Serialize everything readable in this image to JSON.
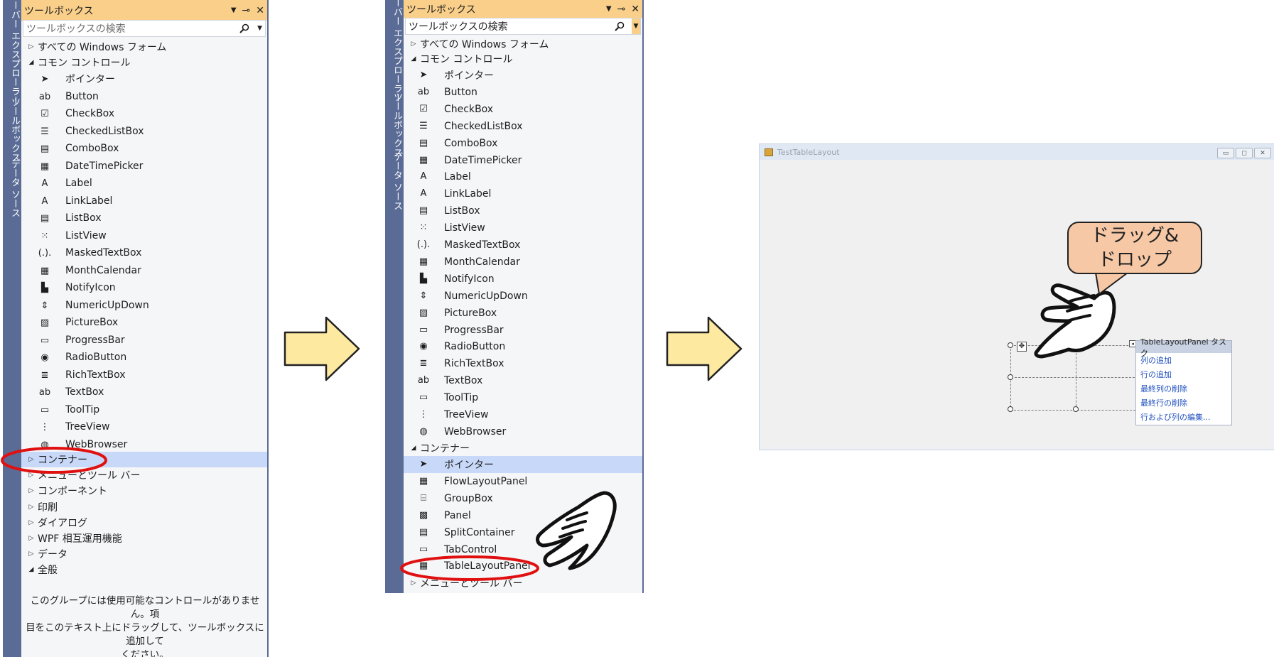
{
  "toolbox_1": {
    "side_tabs": [
      "サーバー エクスプローラー",
      "ツールボックス",
      "データ ソース"
    ],
    "title": "ツールボックス",
    "title_icons": [
      "▼",
      "⊸",
      "✕"
    ],
    "search_placeholder": "ツールボックスの検索",
    "groups_top": [
      {
        "label": "すべての Windows フォーム",
        "expanded": false
      },
      {
        "label": "コモン コントロール",
        "expanded": true
      }
    ],
    "items": [
      {
        "label": "ポインター",
        "icon": "pointer-icon",
        "glyph": "➤"
      },
      {
        "label": "Button",
        "icon": "button-icon",
        "glyph": "ab"
      },
      {
        "label": "CheckBox",
        "icon": "checkbox-icon",
        "glyph": "☑"
      },
      {
        "label": "CheckedListBox",
        "icon": "checked-list-icon",
        "glyph": "☰"
      },
      {
        "label": "ComboBox",
        "icon": "combobox-icon",
        "glyph": "▤"
      },
      {
        "label": "DateTimePicker",
        "icon": "datetime-icon",
        "glyph": "▦"
      },
      {
        "label": "Label",
        "icon": "label-icon",
        "glyph": "A"
      },
      {
        "label": "LinkLabel",
        "icon": "linklabel-icon",
        "glyph": "A"
      },
      {
        "label": "ListBox",
        "icon": "listbox-icon",
        "glyph": "▤"
      },
      {
        "label": "ListView",
        "icon": "listview-icon",
        "glyph": "⁙"
      },
      {
        "label": "MaskedTextBox",
        "icon": "masked-textbox-icon",
        "glyph": "(.)."
      },
      {
        "label": "MonthCalendar",
        "icon": "calendar-icon",
        "glyph": "▦"
      },
      {
        "label": "NotifyIcon",
        "icon": "notify-icon",
        "glyph": "▙"
      },
      {
        "label": "NumericUpDown",
        "icon": "numeric-updown-icon",
        "glyph": "⇕"
      },
      {
        "label": "PictureBox",
        "icon": "picturebox-icon",
        "glyph": "▨"
      },
      {
        "label": "ProgressBar",
        "icon": "progressbar-icon",
        "glyph": "▭"
      },
      {
        "label": "RadioButton",
        "icon": "radio-icon",
        "glyph": "◉"
      },
      {
        "label": "RichTextBox",
        "icon": "richtext-icon",
        "glyph": "≣"
      },
      {
        "label": "TextBox",
        "icon": "textbox-icon",
        "glyph": "ab"
      },
      {
        "label": "ToolTip",
        "icon": "tooltip-icon",
        "glyph": "▭"
      },
      {
        "label": "TreeView",
        "icon": "treeview-icon",
        "glyph": "⋮"
      },
      {
        "label": "WebBrowser",
        "icon": "webbrowser-icon",
        "glyph": "◍"
      }
    ],
    "groups_bottom": [
      {
        "label": "コンテナー",
        "expanded": false,
        "selected": true
      },
      {
        "label": "メニューとツール バー",
        "expanded": false
      },
      {
        "label": "コンポーネント",
        "expanded": false
      },
      {
        "label": "印刷",
        "expanded": false
      },
      {
        "label": "ダイアログ",
        "expanded": false
      },
      {
        "label": "WPF 相互運用機能",
        "expanded": false
      },
      {
        "label": "データ",
        "expanded": false
      },
      {
        "label": "全般",
        "expanded": true
      }
    ],
    "empty_note_lines": [
      "このグループには使用可能なコントロールがありません。項",
      "目をこのテキスト上にドラッグして、ツールボックスに追加して",
      "ください。"
    ]
  },
  "toolbox_2": {
    "side_tabs": [
      "サーバー エクスプローラー",
      "ツールボックス",
      "データ ソース"
    ],
    "title": "ツールボックス",
    "title_icons": [
      "▼",
      "⊸",
      "✕"
    ],
    "search_text": "ツールボックスの検索",
    "groups_top": [
      {
        "label": "すべての Windows フォーム",
        "expanded": false
      },
      {
        "label": "コモン コントロール",
        "expanded": true
      }
    ],
    "items": [
      {
        "label": "ポインター",
        "icon": "pointer-icon",
        "glyph": "➤"
      },
      {
        "label": "Button",
        "icon": "button-icon",
        "glyph": "ab"
      },
      {
        "label": "CheckBox",
        "icon": "checkbox-icon",
        "glyph": "☑"
      },
      {
        "label": "CheckedListBox",
        "icon": "checked-list-icon",
        "glyph": "☰"
      },
      {
        "label": "ComboBox",
        "icon": "combobox-icon",
        "glyph": "▤"
      },
      {
        "label": "DateTimePicker",
        "icon": "datetime-icon",
        "glyph": "▦"
      },
      {
        "label": "Label",
        "icon": "label-icon",
        "glyph": "A"
      },
      {
        "label": "LinkLabel",
        "icon": "linklabel-icon",
        "glyph": "A"
      },
      {
        "label": "ListBox",
        "icon": "listbox-icon",
        "glyph": "▤"
      },
      {
        "label": "ListView",
        "icon": "listview-icon",
        "glyph": "⁙"
      },
      {
        "label": "MaskedTextBox",
        "icon": "masked-textbox-icon",
        "glyph": "(.)."
      },
      {
        "label": "MonthCalendar",
        "icon": "calendar-icon",
        "glyph": "▦"
      },
      {
        "label": "NotifyIcon",
        "icon": "notify-icon",
        "glyph": "▙"
      },
      {
        "label": "NumericUpDown",
        "icon": "numeric-updown-icon",
        "glyph": "⇕"
      },
      {
        "label": "PictureBox",
        "icon": "picturebox-icon",
        "glyph": "▨"
      },
      {
        "label": "ProgressBar",
        "icon": "progressbar-icon",
        "glyph": "▭"
      },
      {
        "label": "RadioButton",
        "icon": "radio-icon",
        "glyph": "◉"
      },
      {
        "label": "RichTextBox",
        "icon": "richtext-icon",
        "glyph": "≣"
      },
      {
        "label": "TextBox",
        "icon": "textbox-icon",
        "glyph": "ab"
      },
      {
        "label": "ToolTip",
        "icon": "tooltip-icon",
        "glyph": "▭"
      },
      {
        "label": "TreeView",
        "icon": "treeview-icon",
        "glyph": "⋮"
      },
      {
        "label": "WebBrowser",
        "icon": "webbrowser-icon",
        "glyph": "◍"
      }
    ],
    "container_group": {
      "label": "コンテナー",
      "expanded": true
    },
    "container_items": [
      {
        "label": "ポインター",
        "icon": "pointer-icon",
        "glyph": "➤",
        "selected": true
      },
      {
        "label": "FlowLayoutPanel",
        "icon": "flowlayout-icon",
        "glyph": "▦"
      },
      {
        "label": "GroupBox",
        "icon": "groupbox-icon",
        "glyph": "⌸"
      },
      {
        "label": "Panel",
        "icon": "panel-icon",
        "glyph": "▩"
      },
      {
        "label": "SplitContainer",
        "icon": "splitcontainer-icon",
        "glyph": "▤"
      },
      {
        "label": "TabControl",
        "icon": "tabcontrol-icon",
        "glyph": "▭"
      },
      {
        "label": "TableLayoutPanel",
        "icon": "tablelayout-icon",
        "glyph": "▦"
      }
    ],
    "next_group": {
      "label": "メニューとツール バー",
      "expanded": false
    }
  },
  "form": {
    "title": "TestTableLayout",
    "window_buttons": [
      "▭",
      "◻",
      "✕"
    ],
    "tasks_title": "TableLayoutPanel タスク",
    "task_links": [
      "列の追加",
      "行の追加",
      "最終列の削除",
      "最終行の削除",
      "行および列の編集..."
    ]
  },
  "callout": {
    "line1": "ドラッグ&",
    "line2": "ドロップ"
  },
  "colors": {
    "title_bar": "#f9cf8a",
    "side_strip": "#5a6b95",
    "selection": "#c8d8f8",
    "arrow_fill": "#fde9a0",
    "highlight_ellipse": "#e01010",
    "callout_fill": "#f6c8a5"
  }
}
